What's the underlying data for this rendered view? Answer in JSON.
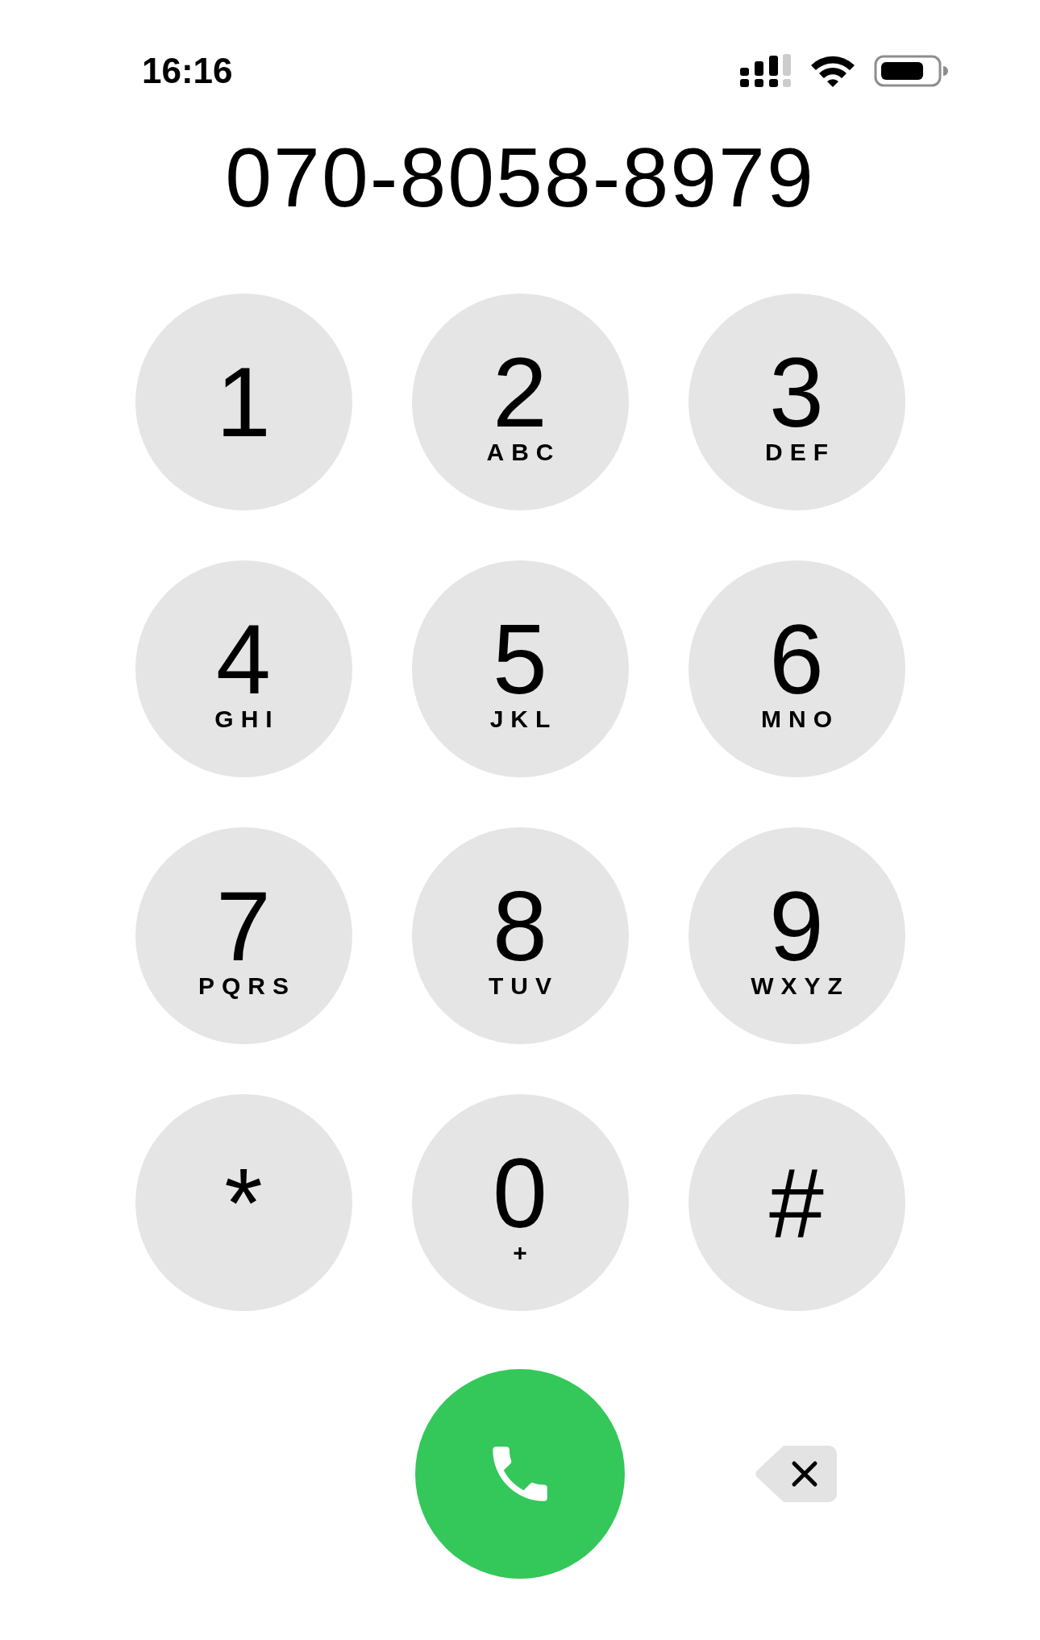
{
  "status_bar": {
    "time": "16:16"
  },
  "dialed_number": "070-8058-8979",
  "keys": [
    {
      "digit": "1"
    },
    {
      "digit": "2",
      "letters": "ABC"
    },
    {
      "digit": "3",
      "letters": "DEF"
    },
    {
      "digit": "4",
      "letters": "GHI"
    },
    {
      "digit": "5",
      "letters": "JKL"
    },
    {
      "digit": "6",
      "letters": "MNO"
    },
    {
      "digit": "7",
      "letters": "PQRS"
    },
    {
      "digit": "8",
      "letters": "TUV"
    },
    {
      "digit": "9",
      "letters": "WXYZ"
    },
    {
      "digit": "*"
    },
    {
      "digit": "0",
      "letters": "+"
    },
    {
      "digit": "#"
    }
  ]
}
